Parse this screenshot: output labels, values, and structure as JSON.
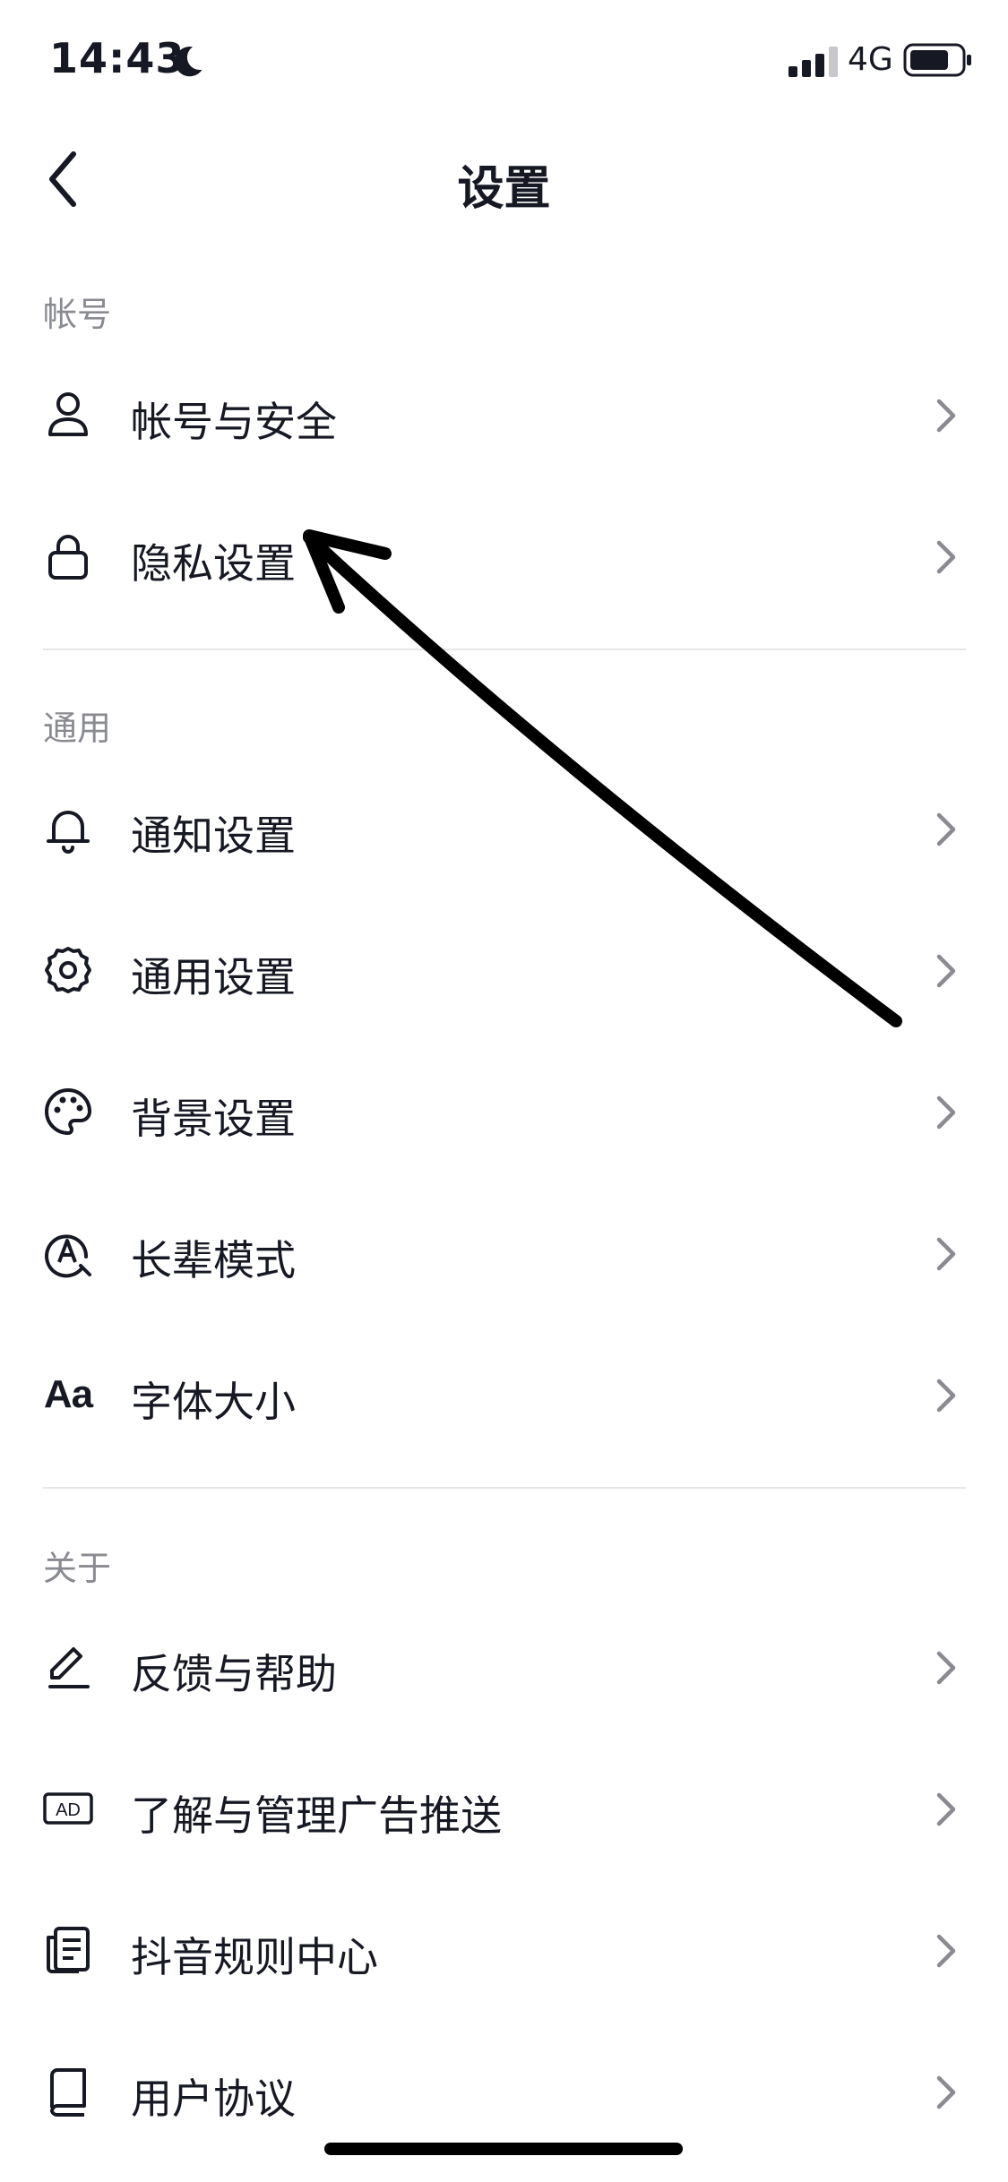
{
  "status_bar": {
    "time": "14:43",
    "network": "4G",
    "icons": [
      "moon-icon",
      "signal-icon",
      "battery-icon"
    ]
  },
  "nav": {
    "title": "设置",
    "back_icon": "chevron-left-icon"
  },
  "sections": [
    {
      "header": "帐号",
      "items": [
        {
          "label": "帐号与安全",
          "icon": "user-icon"
        },
        {
          "label": "隐私设置",
          "icon": "lock-icon"
        }
      ]
    },
    {
      "header": "通用",
      "items": [
        {
          "label": "通知设置",
          "icon": "bell-icon"
        },
        {
          "label": "通用设置",
          "icon": "gear-icon"
        },
        {
          "label": "背景设置",
          "icon": "palette-icon"
        },
        {
          "label": "长辈模式",
          "icon": "elder-mode-icon"
        },
        {
          "label": "字体大小",
          "icon": "font-size-icon",
          "icon_text": "Aa"
        }
      ]
    },
    {
      "header": "关于",
      "items": [
        {
          "label": "反馈与帮助",
          "icon": "edit-icon"
        },
        {
          "label": "了解与管理广告推送",
          "icon": "ad-icon",
          "icon_text": "AD"
        },
        {
          "label": "抖音规则中心",
          "icon": "rules-doc-icon"
        },
        {
          "label": "用户协议",
          "icon": "book-icon"
        }
      ]
    }
  ],
  "annotation": {
    "type": "arrow",
    "color": "#000000",
    "points_to": "隐私设置"
  },
  "colors": {
    "text": "#161823",
    "secondary_text": "#8a8b91",
    "divider": "#e6e6e8",
    "chevron": "#8a8b91"
  }
}
